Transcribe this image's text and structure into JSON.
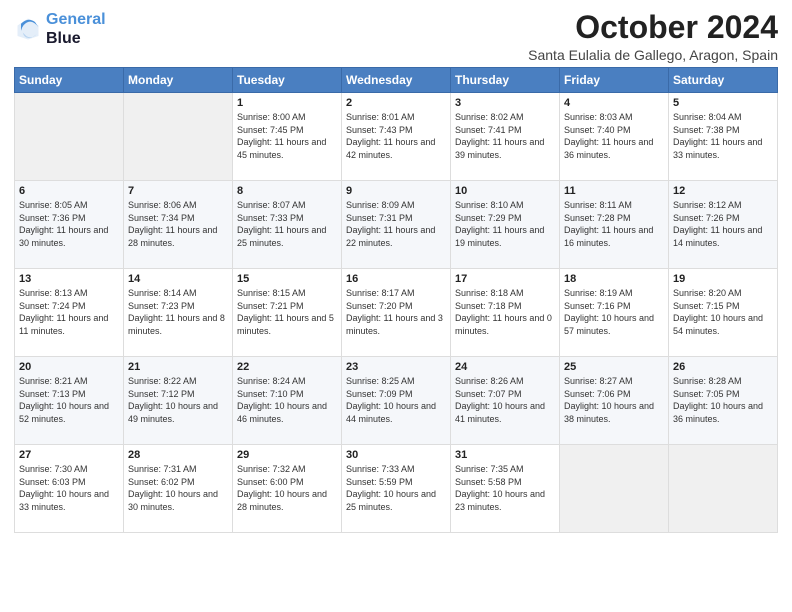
{
  "header": {
    "logo_line1": "General",
    "logo_line2": "Blue",
    "month_title": "October 2024",
    "location": "Santa Eulalia de Gallego, Aragon, Spain"
  },
  "days_of_week": [
    "Sunday",
    "Monday",
    "Tuesday",
    "Wednesday",
    "Thursday",
    "Friday",
    "Saturday"
  ],
  "weeks": [
    [
      {
        "day": "",
        "info": ""
      },
      {
        "day": "",
        "info": ""
      },
      {
        "day": "1",
        "info": "Sunrise: 8:00 AM\nSunset: 7:45 PM\nDaylight: 11 hours and 45 minutes."
      },
      {
        "day": "2",
        "info": "Sunrise: 8:01 AM\nSunset: 7:43 PM\nDaylight: 11 hours and 42 minutes."
      },
      {
        "day": "3",
        "info": "Sunrise: 8:02 AM\nSunset: 7:41 PM\nDaylight: 11 hours and 39 minutes."
      },
      {
        "day": "4",
        "info": "Sunrise: 8:03 AM\nSunset: 7:40 PM\nDaylight: 11 hours and 36 minutes."
      },
      {
        "day": "5",
        "info": "Sunrise: 8:04 AM\nSunset: 7:38 PM\nDaylight: 11 hours and 33 minutes."
      }
    ],
    [
      {
        "day": "6",
        "info": "Sunrise: 8:05 AM\nSunset: 7:36 PM\nDaylight: 11 hours and 30 minutes."
      },
      {
        "day": "7",
        "info": "Sunrise: 8:06 AM\nSunset: 7:34 PM\nDaylight: 11 hours and 28 minutes."
      },
      {
        "day": "8",
        "info": "Sunrise: 8:07 AM\nSunset: 7:33 PM\nDaylight: 11 hours and 25 minutes."
      },
      {
        "day": "9",
        "info": "Sunrise: 8:09 AM\nSunset: 7:31 PM\nDaylight: 11 hours and 22 minutes."
      },
      {
        "day": "10",
        "info": "Sunrise: 8:10 AM\nSunset: 7:29 PM\nDaylight: 11 hours and 19 minutes."
      },
      {
        "day": "11",
        "info": "Sunrise: 8:11 AM\nSunset: 7:28 PM\nDaylight: 11 hours and 16 minutes."
      },
      {
        "day": "12",
        "info": "Sunrise: 8:12 AM\nSunset: 7:26 PM\nDaylight: 11 hours and 14 minutes."
      }
    ],
    [
      {
        "day": "13",
        "info": "Sunrise: 8:13 AM\nSunset: 7:24 PM\nDaylight: 11 hours and 11 minutes."
      },
      {
        "day": "14",
        "info": "Sunrise: 8:14 AM\nSunset: 7:23 PM\nDaylight: 11 hours and 8 minutes."
      },
      {
        "day": "15",
        "info": "Sunrise: 8:15 AM\nSunset: 7:21 PM\nDaylight: 11 hours and 5 minutes."
      },
      {
        "day": "16",
        "info": "Sunrise: 8:17 AM\nSunset: 7:20 PM\nDaylight: 11 hours and 3 minutes."
      },
      {
        "day": "17",
        "info": "Sunrise: 8:18 AM\nSunset: 7:18 PM\nDaylight: 11 hours and 0 minutes."
      },
      {
        "day": "18",
        "info": "Sunrise: 8:19 AM\nSunset: 7:16 PM\nDaylight: 10 hours and 57 minutes."
      },
      {
        "day": "19",
        "info": "Sunrise: 8:20 AM\nSunset: 7:15 PM\nDaylight: 10 hours and 54 minutes."
      }
    ],
    [
      {
        "day": "20",
        "info": "Sunrise: 8:21 AM\nSunset: 7:13 PM\nDaylight: 10 hours and 52 minutes."
      },
      {
        "day": "21",
        "info": "Sunrise: 8:22 AM\nSunset: 7:12 PM\nDaylight: 10 hours and 49 minutes."
      },
      {
        "day": "22",
        "info": "Sunrise: 8:24 AM\nSunset: 7:10 PM\nDaylight: 10 hours and 46 minutes."
      },
      {
        "day": "23",
        "info": "Sunrise: 8:25 AM\nSunset: 7:09 PM\nDaylight: 10 hours and 44 minutes."
      },
      {
        "day": "24",
        "info": "Sunrise: 8:26 AM\nSunset: 7:07 PM\nDaylight: 10 hours and 41 minutes."
      },
      {
        "day": "25",
        "info": "Sunrise: 8:27 AM\nSunset: 7:06 PM\nDaylight: 10 hours and 38 minutes."
      },
      {
        "day": "26",
        "info": "Sunrise: 8:28 AM\nSunset: 7:05 PM\nDaylight: 10 hours and 36 minutes."
      }
    ],
    [
      {
        "day": "27",
        "info": "Sunrise: 7:30 AM\nSunset: 6:03 PM\nDaylight: 10 hours and 33 minutes."
      },
      {
        "day": "28",
        "info": "Sunrise: 7:31 AM\nSunset: 6:02 PM\nDaylight: 10 hours and 30 minutes."
      },
      {
        "day": "29",
        "info": "Sunrise: 7:32 AM\nSunset: 6:00 PM\nDaylight: 10 hours and 28 minutes."
      },
      {
        "day": "30",
        "info": "Sunrise: 7:33 AM\nSunset: 5:59 PM\nDaylight: 10 hours and 25 minutes."
      },
      {
        "day": "31",
        "info": "Sunrise: 7:35 AM\nSunset: 5:58 PM\nDaylight: 10 hours and 23 minutes."
      },
      {
        "day": "",
        "info": ""
      },
      {
        "day": "",
        "info": ""
      }
    ]
  ]
}
